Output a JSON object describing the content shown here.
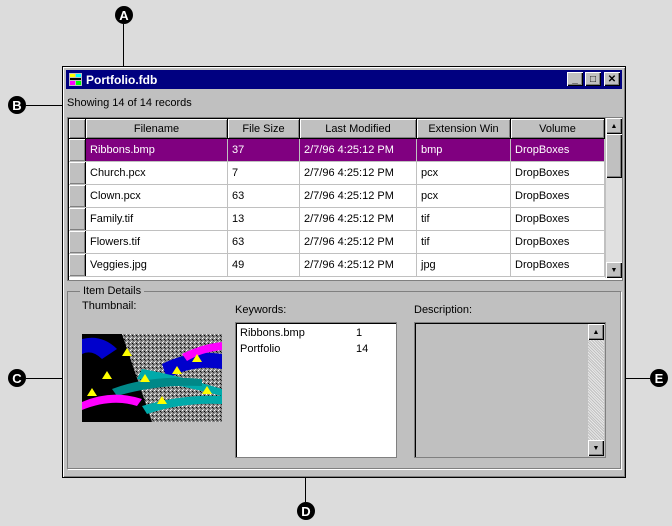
{
  "callouts": {
    "a": "A",
    "b": "B",
    "c": "C",
    "d": "D",
    "e": "E"
  },
  "window": {
    "title": "Portfolio.fdb",
    "minimize": "_",
    "maximize": "□",
    "close": "✕"
  },
  "status": "Showing 14 of 14 records",
  "grid": {
    "columns": [
      "Filename",
      "File Size",
      "Last Modified",
      "Extension Win",
      "Volume"
    ],
    "rows": [
      [
        "Ribbons.bmp",
        "37",
        "2/7/96 4:25:12 PM",
        "bmp",
        "DropBoxes"
      ],
      [
        "Church.pcx",
        "7",
        "2/7/96 4:25:12 PM",
        "pcx",
        "DropBoxes"
      ],
      [
        "Clown.pcx",
        "63",
        "2/7/96 4:25:12 PM",
        "pcx",
        "DropBoxes"
      ],
      [
        "Family.tif",
        "13",
        "2/7/96 4:25:12 PM",
        "tif",
        "DropBoxes"
      ],
      [
        "Flowers.tif",
        "63",
        "2/7/96 4:25:12 PM",
        "tif",
        "DropBoxes"
      ],
      [
        "Veggies.jpg",
        "49",
        "2/7/96 4:25:12 PM",
        "jpg",
        "DropBoxes"
      ]
    ],
    "selected_row": 0
  },
  "details": {
    "group_title": "Item Details",
    "thumbnail_label": "Thumbnail:",
    "keywords_label": "Keywords:",
    "description_label": "Description:",
    "keywords": [
      {
        "name": "Ribbons.bmp",
        "count": "1"
      },
      {
        "name": "Portfolio",
        "count": "14"
      }
    ]
  },
  "colors": {
    "titlebar": "#000080",
    "selection": "#800080"
  }
}
